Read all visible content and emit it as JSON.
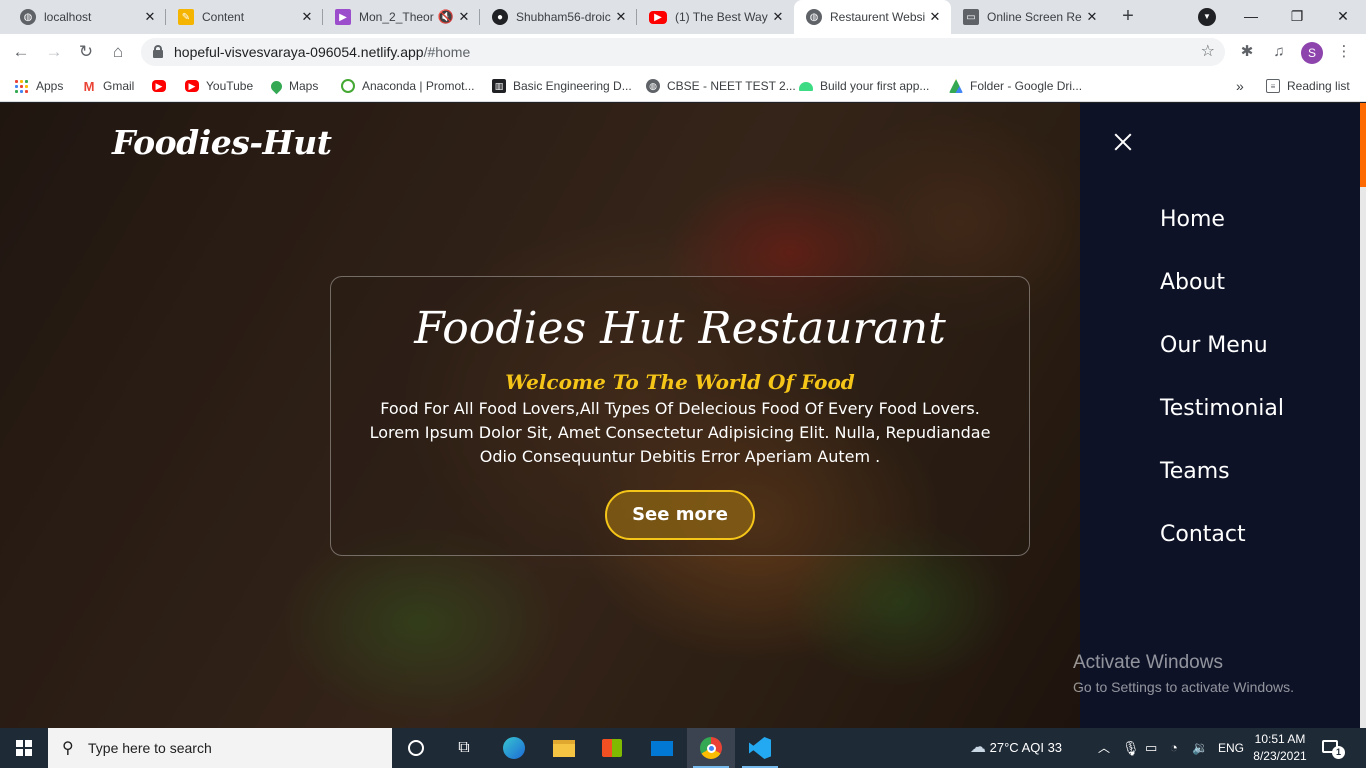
{
  "browser": {
    "tabs": [
      {
        "title": "localhost",
        "icon": "globe-icon"
      },
      {
        "title": "Content",
        "icon": "pencil-icon"
      },
      {
        "title": "Mon_2_Theor",
        "icon": "play-icon"
      },
      {
        "title": "Shubham56-droic",
        "icon": "github-icon"
      },
      {
        "title": "(1) The Best Way",
        "icon": "youtube-icon"
      },
      {
        "title": "Restaurent Websi",
        "icon": "globe-icon"
      },
      {
        "title": "Online Screen Re",
        "icon": "monitor-icon"
      }
    ],
    "active_tab_index": 5,
    "new_tab_label": "+",
    "url_host": "hopeful-visvesvaraya-096054.netlify.app",
    "url_path": "/#home",
    "profile_initial": "S"
  },
  "bookmarks": {
    "items": [
      {
        "label": "Apps"
      },
      {
        "label": "Gmail"
      },
      {
        "label": ""
      },
      {
        "label": "YouTube"
      },
      {
        "label": "Maps"
      },
      {
        "label": "Anaconda | Promot..."
      },
      {
        "label": "Basic Engineering D..."
      },
      {
        "label": "CBSE - NEET TEST 2..."
      },
      {
        "label": "Build your first app..."
      },
      {
        "label": "Folder - Google Dri..."
      }
    ],
    "overflow": "»",
    "reading_list": "Reading list"
  },
  "site": {
    "logo": "Foodies-Hut",
    "hero": {
      "title": "Foodies Hut Restaurant",
      "subtitle": "Welcome To The World Of Food",
      "body": "Food For All Food Lovers,All Types Of Delecious Food Of Every Food Lovers. Lorem Ipsum Dolor Sit, Amet Consectetur Adipisicing Elit. Nulla, Repudiandae Odio Consequuntur Debitis Error Aperiam Autem .",
      "cta": "See more"
    },
    "nav": [
      {
        "label": "Home"
      },
      {
        "label": "About"
      },
      {
        "label": "Our Menu"
      },
      {
        "label": "Testimonial"
      },
      {
        "label": "Teams"
      },
      {
        "label": "Contact"
      }
    ]
  },
  "watermark": {
    "line1": "Activate Windows",
    "line2": "Go to Settings to activate Windows."
  },
  "taskbar": {
    "search_placeholder": "Type here to search",
    "weather": "27°C  AQI 33",
    "language": "ENG",
    "time": "10:51 AM",
    "date": "8/23/2021",
    "notification_count": "1"
  },
  "colors": {
    "accent_yellow": "#f5c518",
    "sidenav_bg": "#0d1226",
    "scroll_thumb": "#ff6a00"
  }
}
